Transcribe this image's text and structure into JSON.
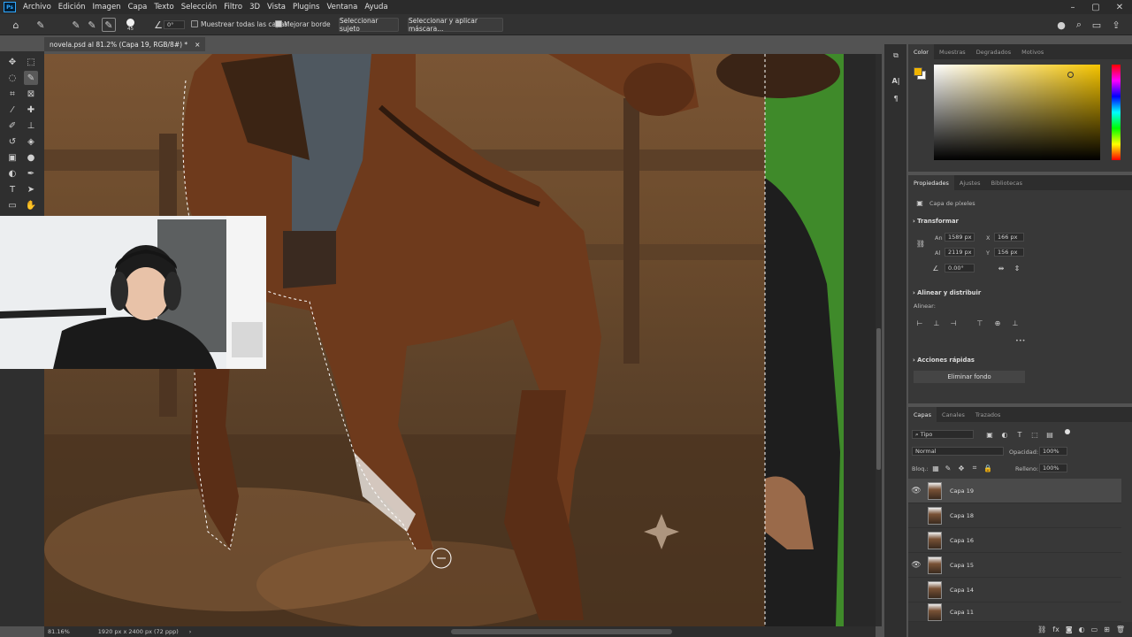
{
  "menu": {
    "logo": "Ps",
    "items": [
      "Archivo",
      "Edición",
      "Imagen",
      "Capa",
      "Texto",
      "Selección",
      "Filtro",
      "3D",
      "Vista",
      "Plugins",
      "Ventana",
      "Ayuda"
    ]
  },
  "window_controls": {
    "minimize": "–",
    "maximize": "▢",
    "close": "✕"
  },
  "options": {
    "brush_size": "45",
    "angle": "0°",
    "sample_all_layers": "Muestrear todas las capas",
    "sample_all_layers_checked": false,
    "enhance_edge": "Mejorar borde",
    "enhance_edge_checked": true,
    "select_subject": "Seleccionar sujeto",
    "select_and_mask": "Seleccionar y aplicar máscara..."
  },
  "document_tab": {
    "title": "novela.psd al 81.2% (Capa 19, RGB/8#) *",
    "close": "×"
  },
  "status": {
    "zoom": "81.16%",
    "dimensions": "1920 px x 2400 px (72 ppp)",
    "arrow": "›"
  },
  "color_panel": {
    "tabs": [
      "Color",
      "Muestras",
      "Degradados",
      "Motivos"
    ],
    "foreground": "#f0b400",
    "background": "#ffffff",
    "picker_hue": "#f5c400"
  },
  "properties_panel": {
    "tabs": [
      "Propiedades",
      "Ajustes",
      "Bibliotecas"
    ],
    "kind": "Capa de píxeles",
    "transform_title": "Transformar",
    "w_label": "An",
    "w_value": "1589 px",
    "h_label": "Al",
    "h_value": "2119 px",
    "x_label": "X",
    "x_value": "166 px",
    "y_label": "Y",
    "y_value": "156 px",
    "angle_value": "0.00°",
    "align_title": "Alinear y distribuir",
    "align_label": "Alinear:",
    "quick_actions_title": "Acciones rápidas",
    "remove_bg": "Eliminar fondo",
    "more": "•••"
  },
  "layers_panel": {
    "tabs": [
      "Capas",
      "Canales",
      "Trazados"
    ],
    "filter_kind": "Tipo",
    "blend_mode": "Normal",
    "opacity_label": "Opacidad:",
    "opacity_value": "100%",
    "lock_label": "Bloq.:",
    "fill_label": "Relleno:",
    "fill_value": "100%",
    "layers": [
      {
        "name": "Capa 19",
        "visible": true,
        "selected": true
      },
      {
        "name": "Capa 18",
        "visible": false,
        "selected": false
      },
      {
        "name": "Capa 16",
        "visible": false,
        "selected": false
      },
      {
        "name": "Capa 15",
        "visible": true,
        "selected": false
      },
      {
        "name": "Capa 14",
        "visible": false,
        "selected": false
      },
      {
        "name": "Capa 11",
        "visible": false,
        "selected": false
      }
    ]
  }
}
